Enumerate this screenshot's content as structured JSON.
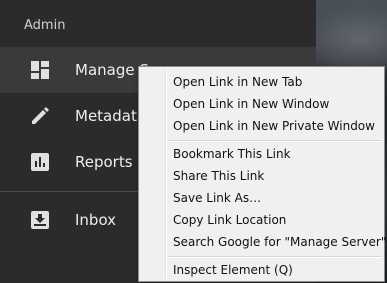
{
  "sidebar": {
    "section_label": "Admin",
    "items": [
      {
        "label": "Manage Server",
        "icon": "dashboard-icon"
      },
      {
        "label": "Metadata",
        "icon": "pencil-icon"
      },
      {
        "label": "Reports",
        "icon": "bar-chart-icon"
      },
      {
        "label": "Inbox",
        "icon": "inbox-icon"
      }
    ]
  },
  "context_menu": {
    "items": [
      "Open Link in New Tab",
      "Open Link in New Window",
      "Open Link in New Private Window",
      "Bookmark This Link",
      "Share This Link",
      "Save Link As…",
      "Copy Link Location",
      "Search Google for \"Manage Server\"",
      "Inspect Element (Q)"
    ]
  },
  "colors": {
    "sidebar_bg": "#2b2b2b",
    "sidebar_active_bg": "#3a3a3a",
    "menu_bg": "#f0f0f0"
  }
}
